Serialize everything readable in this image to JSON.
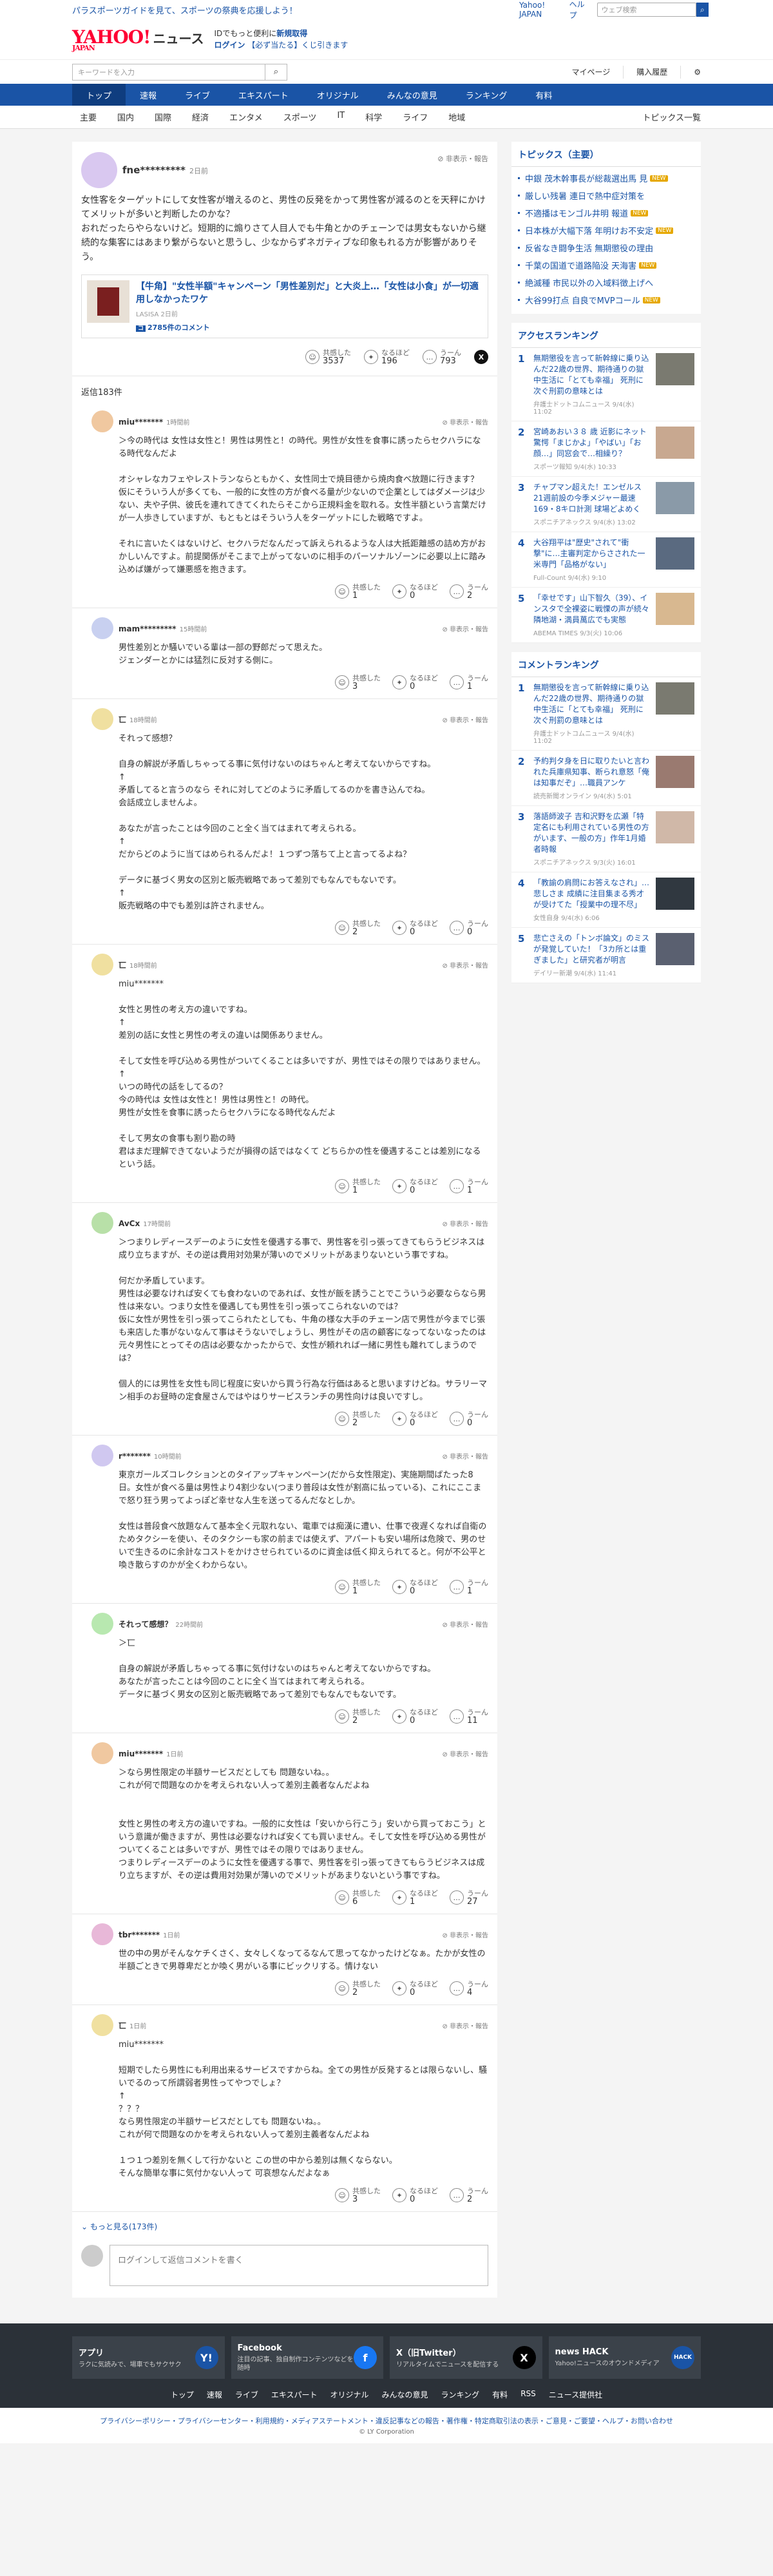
{
  "promo": {
    "text": "パラスポーツガイドを見て、スポーツの祭典を応援しよう！",
    "links": [
      "Yahoo! JAPAN",
      "ヘルプ"
    ],
    "search_placeholder": "ウェブ検索"
  },
  "header": {
    "logo_main": "YAHOO!",
    "logo_sub": "JAPAN",
    "logo_news": "ニュース",
    "line1_pre": "IDでもっと便利に",
    "line1_link": "新規取得",
    "login": "ログイン",
    "line2": "【必ず当たる】くじ引きます"
  },
  "search": {
    "placeholder": "キーワードを入力",
    "mypage": "マイページ",
    "purchase": "購入履歴"
  },
  "nav": {
    "items": [
      "トップ",
      "速報",
      "ライブ",
      "エキスパート",
      "オリジナル",
      "みんなの意見",
      "ランキング",
      "有料"
    ]
  },
  "subnav": {
    "items": [
      "主要",
      "国内",
      "国際",
      "経済",
      "エンタメ",
      "スポーツ",
      "IT",
      "科学",
      "ライフ",
      "地域"
    ],
    "topics": "トピックス一覧"
  },
  "post": {
    "user": "fne*********",
    "time": "2日前",
    "hide": "非表示・報告",
    "body": "女性客をターゲットにして女性客が増えるのと、男性の反発をかって男性客が減るのとを天秤にかけてメリットが多いと判断したのかな？\nおれだったらやらないけど。短期的に煽りさて人目人でも牛角とかのチェーンでは男女もないから継続的な集客にはあまり繋がらないと思うし、少なからずネガティブな印象もれる方が影響がありそう。",
    "article": {
      "title": "【牛角】\"女性半額\"キャンペーン「男性差別だ」と大炎上…「女性は小食」が一切適用しなかったワケ",
      "src": "LASISA 2日前",
      "count": "2785件のコメント",
      "count_icon": "コ"
    },
    "react1": {
      "label": "共感した",
      "count": "3537"
    },
    "react2": {
      "label": "なるほど",
      "count": "196"
    },
    "react3": {
      "label": "うーん",
      "count": "793"
    }
  },
  "reply_count": "返信183件",
  "replies": [
    {
      "user": "miu*******",
      "time": "1時間前",
      "color": "#f0c8a0",
      "body": "＞今の時代は 女性は女性と！男性は男性と！の時代。男性が女性を食事に誘ったらセクハラになる時代なんだよ\n\nオシャレなカフェやレストランならともかく、女性同士で焼目徳から焼肉食べ放題に行きます？\n仮にそういう人が多くても、一般的に女性の方が食べる量が少ないので企業としてはダメージは少ない、夫や子供、彼氏を連れてきてくれたらそこから正規料金を取れる。女性半額という言葉だけが一人歩きしていますが、もともとはそういう人をターゲットにした戦略ですよ。\n\nそれに言いたくはないけど、セクハラだなんだって訴えられるような人は大抵距離感の詰め方がおかしいんですよ。前提関係がそこまで上がってないのに相手のパーソナルゾーンに必要以上に踏み込めば嫌がって嫌悪感を抱きます。",
      "c1": "1",
      "c2": "0",
      "c3": "2"
    },
    {
      "user": "mam*********",
      "time": "15時間前",
      "color": "#c8d0f0",
      "body": "男性差別とか騒いでいる輩は一部の野郎だって思えた。\nジェンダーとかには猛烈に反対する側に。",
      "c1": "3",
      "c2": "0",
      "c3": "1"
    },
    {
      "user": "匸",
      "time": "18時間前",
      "color": "#f0e0a0",
      "body": "それって感想？\n\n自身の解説が矛盾しちゃってる事に気付けないのはちゃんと考えてないからですね。\n↑\n矛盾してると言うのなら それに対してどのように矛盾してるのかを書き込んでね。\n会話成立しませんよ。\n\nあなたが言ったことは今回のこと全く当てはまれて考えられる。\n↑\nだからどのように当てはめられるんだよ！１つずつ落ちて上と言ってるよね？\n\nデータに基づく男女の区別と販売戦略であって差別でもなんでもないです。\n↑\n販売戦略の中でも差別は許されません。",
      "c1": "2",
      "c2": "0",
      "c3": "0"
    },
    {
      "user": "匸",
      "time": "18時間前",
      "color": "#f0e0a0",
      "body": "miu*******\n\n女性と男性の考え方の違いですね。\n↑\n差別の話に女性と男性の考えの違いは関係ありません。\n\nそして女性を呼び込める男性がついてくることは多いですが、男性ではその限りではありません。\n↑\nいつの時代の話をしてるの？\n今の時代は 女性は女性と！男性は男性と！の時代。\n男性が女性を食事に誘ったらセクハラになる時代なんだよ\n\nそして男女の食事も割り勘の時\n君はまだ理解できてないようだが損得の話ではなくて どちらかの性を優遇することは差別になるという話。",
      "c1": "1",
      "c2": "0",
      "c3": "1"
    },
    {
      "user": "AvCx",
      "time": "17時間前",
      "color": "#b8e0a8",
      "body": "＞つまりレディースデーのように女性を優遇する事で、男性客を引っ張ってきてもらうビジネスは成り立ちますが、その逆は費用対効果が薄いのでメリットがあまりないという事ですね。\n\n何だか矛盾しています。\n男性は必要なければ安くても食わないのであれば、女性が飯を誘うことでこういう必要ならなら男性は来ない。つまり女性を優遇しても男性を引っ張ってこられないのでは？\n仮に女性が男性を引っ張ってこられたとしても、牛角の様な大手のチェーン店で男性が今までじ張も来店した事がないなんて事はそうないでしょうし、男性がその店の顧客になってないなったのは元々男性にとってその店は必要なかったからで、女性が頼れれば一緒に男性も離れてしまうのでは？\n\n個人的には男性を女性も同じ程度に安いから買う行為な行価はあると思いますけどね。サラリーマン相手のお昼時の定食屋さんではやはりサービスランチの男性向けは良いですし。",
      "c1": "2",
      "c2": "0",
      "c3": "0"
    },
    {
      "user": "r*******",
      "time": "10時間前",
      "color": "#d0c8f0",
      "body": "東京ガールズコレクションとのタイアップキャンペーン(だから女性限定)、実施期間ばたった8日。女性が食べる量は男性より4割少ない(つまり普段は女性が割高に払っている)、これにここまで怒り狂う男ってよっぽど幸せな人生を送ってるんだなとしか。\n\n女性は普段食べ放題なんて基本全く元取れない、電車では痴漢に遭い、仕事で夜遅くなれば自衛のためタクシーを使い、そのタクシーも家の前までは使えず、アパートも安い場所は危険で、男のせいで生きるのに余計なコストをかけさせられているのに資金は低く抑えられてると。何が不公平と喚き散らすのかが全くわからない。",
      "c1": "1",
      "c2": "0",
      "c3": "1"
    },
    {
      "user": "それって感想？",
      "time": "22時間前",
      "color": "#b8e8b0",
      "body": "＞匸\n\n自身の解説が矛盾しちゃってる事に気付けないのはちゃんと考えてないからですね。\nあなたが言ったことは今回のことに全く当てはまれて考えられる。\nデータに基づく男女の区別と販売戦略であって差別でもなんでもないです。",
      "c1": "2",
      "c2": "0",
      "c3": "11"
    },
    {
      "user": "miu*******",
      "time": "1日前",
      "color": "#f0c8a0",
      "body": "＞なら男性限定の半額サービスだとしても 問題ないね。。\nこれが何で問題なのかを考えられない人って差別主義者なんだよね\n\n\n女性と男性の考え方の違いですね。一般的に女性は「安いから行こう」安いから買っておこう」という意識が働きますが、男性は必要なければ安くても買いません。そして女性を呼び込める男性がついてくることは多いですが、男性ではその限りではありません。\nつまりレディースデーのように女性を優遇する事で、男性客を引っ張ってきてもらうビジネスは成り立ちますが、その逆は費用対効果が薄いのでメリットがあまりないという事ですね。",
      "c1": "6",
      "c2": "1",
      "c3": "27"
    },
    {
      "user": "tbr*******",
      "time": "1日前",
      "color": "#e8b8d8",
      "body": "世の中の男がそんなケチくさく、女々しくなってるなんて思ってなかったけどなぁ。たかが女性の半額ごときで男尊卑だとか喚く男がいる事にビックリする。情けない",
      "c1": "2",
      "c2": "0",
      "c3": "4"
    },
    {
      "user": "匸",
      "time": "1日前",
      "color": "#f0e0a0",
      "body": "miu*******\n\n短期でしたら男性にも利用出来るサービスですからね。全ての男性が反発するとは限らないし、騒いでるのって所謂弱者男性ってやつでしょ？\n↑\n？？？\nなら男性限定の半額サービスだとしても 問題ないね。。\nこれが何で問題なのかを考えられない人って差別主義者なんだよね\n\n１つ１つ差別を無くして行かないと この世の中から差別は無くならない。\nそんな簡単な事に気付かない人って 可哀想なんだよなぁ",
      "c1": "3",
      "c2": "0",
      "c3": "2"
    }
  ],
  "reply_react_labels": {
    "r1": "共感した",
    "r2": "なるほど",
    "r3": "うーん"
  },
  "more_replies": "もっと見る(173件)",
  "comment_placeholder": "ログインして返信コメントを書く",
  "sidebar": {
    "topics_title": "トピックス（主要）",
    "topics": [
      {
        "text": "中銀 茂木幹事長が総裁選出馬 見",
        "tag": "NEW",
        "tag_color": "#e6a800"
      },
      {
        "text": "厳しい残暑 連日で熱中症対策を",
        "tag": "",
        "tag_color": ""
      },
      {
        "text": "不適播はモンゴル井明 報道",
        "tag": "NEW",
        "tag_color": "#e6a800"
      },
      {
        "text": "日本株が大幅下落 年明けお不安定",
        "tag": "NEW",
        "tag_color": "#e6a800"
      },
      {
        "text": "反省なき闘争生活 無期懲役の理由",
        "tag": "",
        "tag_color": ""
      },
      {
        "text": "千葉の国道で道路陥没 天海害",
        "tag": "NEW",
        "tag_color": "#e6a800"
      },
      {
        "text": "絶滅種 市民以外の入域料徴上げへ",
        "tag": "",
        "tag_color": ""
      },
      {
        "text": "大谷99打点 自良でMVPコール",
        "tag": "NEW",
        "tag_color": "#e6a800"
      }
    ],
    "access_title": "アクセスランキング",
    "access": [
      {
        "num": "1",
        "text": "無期懲役を言って新幹線に乗り込んだ22歳の世界、期待通りの獄中生活に「とても幸福」 死刑に次ぐ刑罰の意味とは",
        "src": "弁護士ドットコムニュース 9/4(水) 11:02",
        "img": "#7a7a70"
      },
      {
        "num": "2",
        "text": "宮崎あおい３８ 歳 近影にネット驚愕「まじかよ」「やばい」「お顔…」同窓会で…相繰り？",
        "src": "スポーツ報知 9/4(水) 10:33",
        "img": "#c8a890"
      },
      {
        "num": "3",
        "text": "チャプマン超えた！エンゼルス21週前設の今季メジャー最速169・8キロ計測 球場どよめく",
        "src": "スポニチアネックス 9/4(水) 13:02",
        "img": "#8a9aa8"
      },
      {
        "num": "4",
        "text": "大谷翔平は\"歴史\"されて\"衝撃\"に…主審判定からさされた一米専門「品格がない」",
        "src": "Full-Count 9/4(水) 9:10",
        "img": "#5a6a80"
      },
      {
        "num": "5",
        "text": "「幸せです」山下智久（39）、インスタで全裸姿に戦慄の声が続々 隣地湖・満員萬広でも実態",
        "src": "ABEMA TIMES 9/3(火) 10:06",
        "img": "#d8b890"
      }
    ],
    "comment_title": "コメントランキング",
    "comment": [
      {
        "num": "1",
        "text": "無期懲役を言って新幹線に乗り込んだ22歳の世界、期待通りの獄中生活に「とても幸福」 死刑に次ぐ刑罰の意味とは",
        "src": "弁護士ドットコムニュース 9/4(水) 11:02",
        "img": "#7a7a70"
      },
      {
        "num": "2",
        "text": "予約判タ身を日に取りたいと言われた兵庫県知事、断られ意怒「俺は知事だぞ」…職員アンケ",
        "src": "読売新聞オンライン 9/4(水) 5:01",
        "img": "#9a7a70"
      },
      {
        "num": "3",
        "text": "落語師波子 吉和沢野を広瀬「特定名にも利用されている男性の方がいます、一般の方」作年1月婚者時報",
        "src": "スポニチアネックス 9/3(火) 16:01",
        "img": "#d0b8a8"
      },
      {
        "num": "4",
        "text": "「教諭の肩問にお答えなされ」…悲しさま 成績に注目集まる秀才が受けてた「授業中の理不尽」",
        "src": "女性自身 9/4(水) 6:06",
        "img": "#303840"
      },
      {
        "num": "5",
        "text": "悲亡さえの「トンボ論文」のミスが発覚していた！「3カ所とは重ぎました」と研究者が明言",
        "src": "デイリー新潮 9/4(水) 11:41",
        "img": "#5a6070"
      }
    ]
  },
  "footer": {
    "apps": [
      {
        "title": "アプリ",
        "desc": "ラクに気読みで、場車でもサクサク",
        "icon": "Y!",
        "icon_color": "#1a54a6"
      },
      {
        "title": "Facebook",
        "desc": "注目の記事、独自制作コンテンツなどを随時",
        "icon": "f",
        "icon_color": "#1877f2"
      },
      {
        "title": "X（旧Twitter）",
        "desc": "リアルタイムでニュースを配信する",
        "icon": "X",
        "icon_color": "#000000"
      },
      {
        "title": "news HACK",
        "desc": "Yahoo!ニュースのオウンドメディア",
        "icon": "HACK",
        "icon_color": "#1a54a6"
      }
    ],
    "links": [
      "トップ",
      "速報",
      "ライブ",
      "エキスパート",
      "オリジナル",
      "みんなの意見",
      "ランキング",
      "有料",
      "RSS",
      "ニュース提供社"
    ],
    "legal": "プライバシーポリシー・プライバシーセンター・利用規約・メディアステートメント・違反記事などの報告・著作権・特定商取引法の表示・ご意見・ご要望・ヘルプ・お問い合わせ",
    "copy": "© LY Corporation"
  }
}
